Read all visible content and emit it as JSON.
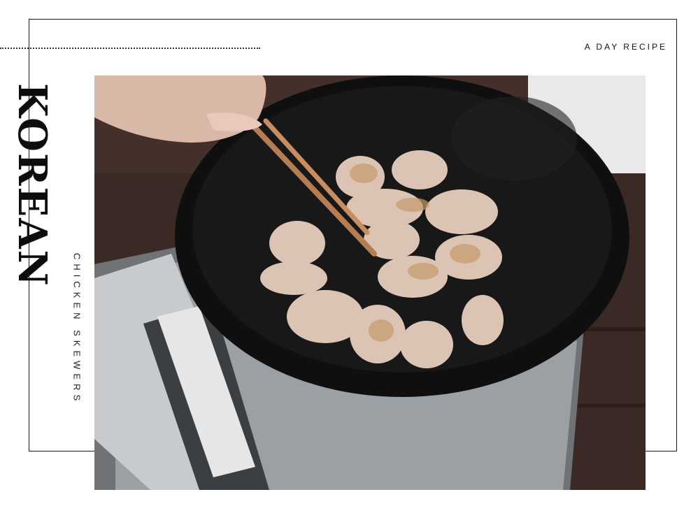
{
  "eyebrow": "A DAY RECIPE",
  "title": "KOREAN",
  "subtitle": "CHICKEN SKEWERS",
  "photo": {
    "subject": "chicken-in-wok-photo"
  },
  "colors": {
    "text": "#0d0d0d",
    "frame": "#1a1a1a",
    "wok": "#151515",
    "table": "#3b2a26",
    "chicken": "#d9c2b4"
  }
}
